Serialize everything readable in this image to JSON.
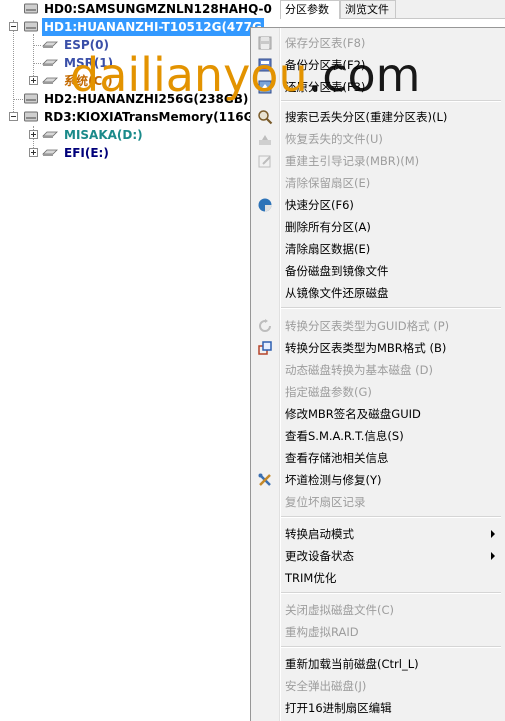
{
  "tree": {
    "items": [
      {
        "label": "HD0:SAMSUNGMZNLN128HAHQ-0"
      },
      {
        "label": "HD1:HUANANZHI-T10512G(477G"
      },
      {
        "label": "ESP(0)"
      },
      {
        "label": "MSR(1)"
      },
      {
        "label": "系统(C:)"
      },
      {
        "label": "HD2:HUANANZHI256G(238GB)"
      },
      {
        "label": "RD3:KIOXIATransMemory(116G"
      },
      {
        "label": "MISAKA(D:)"
      },
      {
        "label": "EFI(E:)"
      }
    ]
  },
  "tabs": [
    {
      "label": "分区参数"
    },
    {
      "label": "浏览文件"
    }
  ],
  "menu": {
    "items": [
      {
        "label": "保存分区表(F8)"
      },
      {
        "label": "备份分区表(F2)"
      },
      {
        "label": "还原分区表(F3)"
      },
      {
        "label": "搜索已丢失分区(重建分区表)(L)"
      },
      {
        "label": "恢复丢失的文件(U)"
      },
      {
        "label": "重建主引导记录(MBR)(M)"
      },
      {
        "label": "清除保留扇区(E)"
      },
      {
        "label": "快速分区(F6)"
      },
      {
        "label": "删除所有分区(A)"
      },
      {
        "label": "清除扇区数据(E)"
      },
      {
        "label": "备份磁盘到镜像文件"
      },
      {
        "label": "从镜像文件还原磁盘"
      },
      {
        "label": "转换分区表类型为GUID格式 (P)"
      },
      {
        "label": "转换分区表类型为MBR格式 (B)"
      },
      {
        "label": "动态磁盘转换为基本磁盘 (D)"
      },
      {
        "label": "指定磁盘参数(G)"
      },
      {
        "label": "修改MBR签名及磁盘GUID"
      },
      {
        "label": "查看S.M.A.R.T.信息(S)"
      },
      {
        "label": "查看存储池相关信息"
      },
      {
        "label": "坏道检测与修复(Y)"
      },
      {
        "label": "复位坏扇区记录"
      },
      {
        "label": "转换启动模式"
      },
      {
        "label": "更改设备状态"
      },
      {
        "label": "TRIM优化"
      },
      {
        "label": "关闭虚拟磁盘文件(C)"
      },
      {
        "label": "重构虚拟RAID"
      },
      {
        "label": "重新加载当前磁盘(Ctrl_L)"
      },
      {
        "label": "安全弹出磁盘(J)"
      },
      {
        "label": "打开16进制扇区编辑"
      }
    ]
  },
  "watermark": {
    "brand": "dailianyou",
    "suffix": ".com"
  },
  "colors": {
    "selection": "#3399ff",
    "menu_bg": "#f1f1f1",
    "disabled_text": "#9d9d9d",
    "partition_blue": "#3a4fa8",
    "partition_teal": "#1a8a8a"
  }
}
